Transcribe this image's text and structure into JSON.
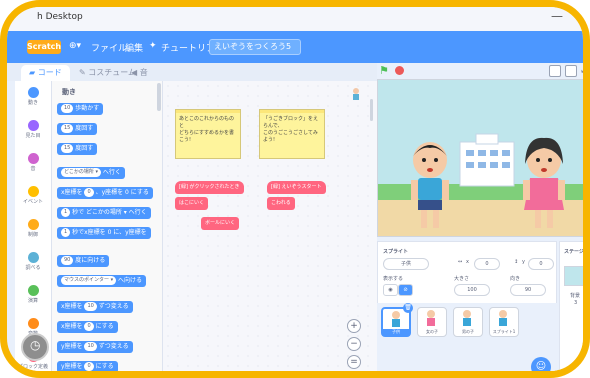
{
  "window": {
    "title": "h Desktop"
  },
  "menubar": {
    "logo": "Scratch",
    "language_label": "",
    "file": "ファイル",
    "edit": "編集",
    "tutorial": "チュートリアル",
    "project_title": "えいぞうをつくろう5"
  },
  "tabs": {
    "code": "コード",
    "costume": "コスチューム",
    "sound": "音"
  },
  "categories": [
    {
      "label": "動き",
      "color": "#4c97ff"
    },
    {
      "label": "見た目",
      "color": "#9966ff"
    },
    {
      "label": "音",
      "color": "#cf63cf"
    },
    {
      "label": "イベント",
      "color": "#ffbf00"
    },
    {
      "label": "制御",
      "color": "#ffab19"
    },
    {
      "label": "調べる",
      "color": "#5cb1d6"
    },
    {
      "label": "演算",
      "color": "#59c059"
    },
    {
      "label": "変数",
      "color": "#ff8c1a"
    },
    {
      "label": "ブロック定義",
      "color": "#ff6680"
    }
  ],
  "palette": {
    "section": "動き",
    "blocks": [
      {
        "pre": "",
        "val": "10",
        "post": "歩動かす"
      },
      {
        "pre": "",
        "val": "15",
        "post": "度回す"
      },
      {
        "pre": "",
        "val": "15",
        "post": "度回す"
      },
      {
        "pre": "",
        "val": "どこかの場所 ▾",
        "post": "へ行く"
      },
      {
        "pre": "x座標を",
        "val": "0",
        "post": "、y座標を 0 にする"
      },
      {
        "pre": "",
        "val": "1",
        "post": "秒で どこかの場所 ▾ へ行く"
      },
      {
        "pre": "",
        "val": "1",
        "post": "秒でx座標を 0 に、y座標を"
      },
      {
        "pre": "",
        "val": "90",
        "post": "度に向ける"
      },
      {
        "pre": "",
        "val": "マウスのポインター ▾",
        "post": "へ向ける"
      },
      {
        "pre": "x座標を",
        "val": "10",
        "post": "ずつ変える"
      },
      {
        "pre": "x座標を",
        "val": "0",
        "post": "にする"
      },
      {
        "pre": "y座標を",
        "val": "10",
        "post": "ずつ変える"
      },
      {
        "pre": "y座標を",
        "val": "0",
        "post": "にする"
      }
    ]
  },
  "workspace": {
    "note1": "あとこのこれからのものと\nどちらにすすめるかを書こう!",
    "note2": "「うごきブロック」をえらんで、\nこのうごこうごさしてみよう!",
    "block_when1": "[緑] がクリックされたとき",
    "block_send": "はこにいく",
    "block_loose": "ボールにいく",
    "block_when2": "[緑] えいぞうスタート",
    "block_end": "こわれる",
    "zoom_in": "+",
    "zoom_out": "−",
    "zoom_reset": "="
  },
  "sprite": {
    "label": "スプライト",
    "name": "子供",
    "x_label": "x",
    "x": "0",
    "y_label": "y",
    "y": "0",
    "show_label": "表示する",
    "size_label": "大きさ",
    "size": "100",
    "direction_label": "向き",
    "direction": "90"
  },
  "sprite_list": [
    "子供",
    "女の子",
    "男の子",
    "スプライト1"
  ],
  "stage_pane": {
    "title": "ステージ",
    "bg_label": "背景",
    "bg_count": "3"
  }
}
